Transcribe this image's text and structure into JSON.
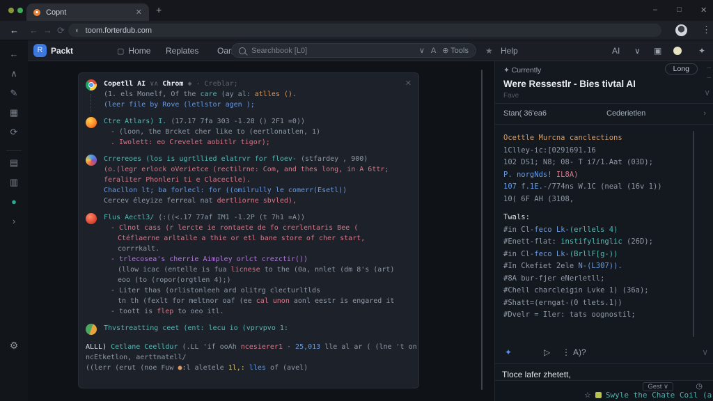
{
  "colors": {
    "accent_teal": "#56b8b4",
    "accent_pink": "#d77787",
    "accent_blue": "#6a9ae0",
    "accent_purple": "#b07ad6",
    "accent_orange": "#d79a62",
    "brand_blue": "#3b78e0",
    "panel_bg": "#14181f",
    "card_bg": "#1c212a"
  },
  "icons": {
    "back": "←",
    "fwd": "→",
    "reload": "⟳",
    "close": "✕",
    "plus": "+",
    "minimize": "–",
    "maximize": "□",
    "kebab": "⋮",
    "globe": "◐",
    "star": "★",
    "star_o": "☆",
    "gear": "⚙",
    "chev_down": "∨",
    "chev_right": "›",
    "play": "▷",
    "diamond": "◆",
    "sparkle": "✦",
    "tools": "⊕ Tools",
    "person": "A",
    "clip": "▣",
    "dash": "–"
  },
  "window": {
    "tab_title": "Copnt",
    "url": "toom.forterdub.com"
  },
  "rail": {
    "items": [
      {
        "g": "←",
        "n": "back"
      },
      {
        "g": "∧",
        "n": "caret-up"
      },
      {
        "g": "✎",
        "n": "edit"
      },
      {
        "g": "▦",
        "n": "grid"
      },
      {
        "g": "⟳",
        "n": "history"
      },
      {
        "g": "",
        "n": "divider"
      },
      {
        "g": "▤",
        "n": "folder"
      },
      {
        "g": "▥",
        "n": "apps"
      },
      {
        "g": "●",
        "n": "status"
      },
      {
        "g": "›",
        "n": "expand"
      }
    ],
    "bottom_glyph": "⚙"
  },
  "nav": {
    "brand": "Packt",
    "brand_glyph": "R",
    "items": [
      "Home",
      "Replates",
      "Oama"
    ],
    "home_icon": "▢",
    "search_placeholder": "Searchbook [L0]",
    "help": "Help",
    "ai": "AI"
  },
  "chat": {
    "messages": [
      {
        "avatar": "av-chrome",
        "thread": true,
        "header": [
          {
            "t": "Copetll AI",
            "c": "wb"
          },
          {
            "t": " ∨∧ ",
            "c": "f"
          },
          {
            "t": "Chrom",
            "c": "wb"
          },
          {
            "t": " ◆",
            "c": "f"
          },
          {
            "t": "   · Creblar;",
            "c": "f"
          }
        ],
        "lines": [
          {
            "ind": 0,
            "segs": [
              {
                "t": "(1. els Monelf, Of the ",
                "c": "g"
              },
              {
                "t": "care",
                "c": "t"
              },
              {
                "t": " (ay al: ",
                "c": "g"
              },
              {
                "t": "atlles ()",
                "c": "o"
              },
              {
                "t": ".",
                "c": "g"
              }
            ]
          },
          {
            "ind": 0,
            "segs": [
              {
                "t": "(leer file by Rove (letlstor agen );",
                "c": "b"
              }
            ]
          }
        ]
      },
      {
        "avatar": "av-firefox",
        "header": [
          {
            "t": "Ctre Atlars) I. ",
            "c": "t"
          },
          {
            "t": "(17.17 7fa 303 -1.28 () 2F1 =0))",
            "c": "g"
          }
        ],
        "lines": [
          {
            "ind": 1,
            "segs": [
              {
                "t": "- (loon, the Brcket cher like to (eertlonatlen, 1)",
                "c": "g"
              }
            ]
          },
          {
            "ind": 1,
            "segs": [
              {
                "t": ". Iwolett: eo Crevelet aobitlr tigor);",
                "c": "p"
              }
            ]
          }
        ]
      },
      {
        "avatar": "av-swirl",
        "header": [
          {
            "t": "Crrereoes (los is ugrtllied elatrvr for floev- ",
            "c": "t"
          },
          {
            "t": "(stfardey , 900)",
            "c": "g"
          }
        ],
        "lines": [
          {
            "ind": 0,
            "segs": [
              {
                "t": "(o.(legr erlock oVerietce (rectilrne: Com, and thes long, in A 6ttr;",
                "c": "p"
              }
            ]
          },
          {
            "ind": 0,
            "segs": [
              {
                "t": "feraliter Phonleri ti e Clacectle).",
                "c": "p"
              }
            ]
          },
          {
            "ind": 0,
            "segs": [
              {
                "t": "Chacllon lt; ba forlecl: for ((omilrully le comerr(Esetl))",
                "c": "b"
              }
            ]
          },
          {
            "ind": 0,
            "segs": [
              {
                "t": "Cercev éleyize ferreal nat ",
                "c": "g"
              },
              {
                "t": "dertliorne sbvled),",
                "c": "p"
              }
            ]
          }
        ]
      },
      {
        "avatar": "av-red",
        "header": [
          {
            "t": "Flus Aectl3/ ",
            "c": "t"
          },
          {
            "t": "(:((<.17 77af IM1 -1.2P (t 7h1 =A))",
            "c": "g"
          }
        ],
        "lines": [
          {
            "ind": 1,
            "segs": [
              {
                "t": "- Clnot cass (r lercte ie rontaete de fo crerlentaris Bee (",
                "c": "p"
              }
            ]
          },
          {
            "ind": 2,
            "segs": [
              {
                "t": "Ctéflaerne arltalle a thie or etl bane store of cher start,",
                "c": "p"
              }
            ]
          },
          {
            "ind": 2,
            "segs": [
              {
                "t": "corrrkalt.",
                "c": "g"
              }
            ]
          },
          {
            "ind": 1,
            "segs": [
              {
                "t": "- trlecosea's cherrie Aimpley orlct crezctir())",
                "c": "u"
              }
            ]
          },
          {
            "ind": 2,
            "segs": [
              {
                "t": "(llow icac (entelle is fua ",
                "c": "g"
              },
              {
                "t": "licnese",
                "c": "p"
              },
              {
                "t": " to the (0a, nnlet (dm 8's (art)",
                "c": "g"
              }
            ]
          },
          {
            "ind": 2,
            "segs": [
              {
                "t": "eoo (to (ropor(orgtlen 4);)",
                "c": "g"
              }
            ]
          },
          {
            "ind": 1,
            "segs": [
              {
                "t": "- Liter thas (orlistonleeh ard olitrg clecturltlds",
                "c": "g"
              }
            ]
          },
          {
            "ind": 2,
            "segs": [
              {
                "t": "tn th (fexlt for meltnor oaf (ee ",
                "c": "g"
              },
              {
                "t": "cal unon",
                "c": "p"
              },
              {
                "t": " aonl eestr is engared it",
                "c": "g"
              }
            ]
          },
          {
            "ind": 1,
            "segs": [
              {
                "t": "- toott is ",
                "c": "g"
              },
              {
                "t": "flep",
                "c": "p"
              },
              {
                "t": " to oeo itl.",
                "c": "g"
              }
            ]
          }
        ]
      },
      {
        "avatar": "av-leaf",
        "header": [
          {
            "t": "Thvstreatting ceet (ent: lecu io (vprvpvo 1:",
            "c": "t"
          }
        ],
        "lines": []
      }
    ],
    "footer_lines": [
      {
        "ind": 0,
        "segs": [
          {
            "t": "ALLL) ",
            "c": "w"
          },
          {
            "t": "Cetlane Ceelldur",
            "c": "t"
          },
          {
            "t": " (.LL 'if ooAh ",
            "c": "g"
          },
          {
            "t": "ncesierer1",
            "c": "p"
          },
          {
            "t": " · ",
            "c": "g"
          },
          {
            "t": "25,013",
            "c": "b"
          },
          {
            "t": " lle al ar ( (lne 't on",
            "c": "g"
          }
        ]
      },
      {
        "ind": 0,
        "segs": [
          {
            "t": "ncEtketlon, aerttnatell/",
            "c": "g"
          }
        ]
      },
      {
        "ind": 0,
        "segs": [
          {
            "t": "((lerr (erut (noe Fuw ",
            "c": "g"
          },
          {
            "t": "●",
            "c": "o"
          },
          {
            "t": ":l aletele ",
            "c": "g"
          },
          {
            "t": "1l,:",
            "c": "y"
          },
          {
            "t": " ",
            "c": "g"
          },
          {
            "t": "lles",
            "c": "b"
          },
          {
            "t": " of (avel)",
            "c": "g"
          }
        ]
      }
    ]
  },
  "panel": {
    "currently": "✦ Currently",
    "long": "Long",
    "title": "Were Ressestlr - Bies tivtal AI",
    "subtitle": "Fave",
    "tab_left": "Stan( 36'ea6",
    "tab_right": "Cederietlen",
    "code_lines": [
      {
        "segs": [
          {
            "t": "Ocettle Murcna canclections",
            "c": "o"
          }
        ]
      },
      {
        "segs": [
          {
            "t": "1Clley-ic:[0291691.16",
            "c": "g"
          }
        ]
      },
      {
        "segs": [
          {
            "t": "102 DS1; N8; 08- T i7/1.Aat (03D);",
            "c": "g"
          }
        ]
      },
      {
        "segs": [
          {
            "t": "P. norgNds! ",
            "c": "b"
          },
          {
            "t": "IL8A)",
            "c": "p"
          }
        ]
      },
      {
        "segs": [
          {
            "t": "107 f.1E.",
            "c": "b"
          },
          {
            "t": "-/774ns W.1C (neal (16v 1))",
            "c": "g"
          }
        ]
      },
      {
        "segs": [
          {
            "t": "10( 6F AH (3108,",
            "c": "g"
          }
        ]
      }
    ],
    "totals_heading": "Twals:",
    "totals": [
      {
        "segs": [
          {
            "t": "#in Cl-",
            "c": "g"
          },
          {
            "t": "feco Lk-",
            "c": "b"
          },
          {
            "t": "(erllels 4)",
            "c": "t"
          }
        ]
      },
      {
        "segs": [
          {
            "t": "#Enett-flat: ",
            "c": "g"
          },
          {
            "t": "instifylinglic",
            "c": "t"
          },
          {
            "t": " (26D);",
            "c": "g"
          }
        ]
      },
      {
        "segs": [
          {
            "t": "#in Cl-",
            "c": "g"
          },
          {
            "t": "feco Lk-",
            "c": "b"
          },
          {
            "t": "(BrllF[g-))",
            "c": "t"
          }
        ]
      },
      {
        "segs": [
          {
            "t": "#In Ckefiet 2ele ",
            "c": "g"
          },
          {
            "t": "N-(L307))",
            "c": "b"
          },
          {
            "t": ".",
            "c": "g"
          }
        ]
      },
      {
        "segs": [
          {
            "t": "#8A bur-fjer eNerletll;",
            "c": "g"
          }
        ]
      },
      {
        "segs": [
          {
            "t": "#Chell charcleigin Lvke 1) (36a);",
            "c": "g"
          }
        ]
      },
      {
        "segs": [
          {
            "t": "#Shatt=(erngat-(0 tlets.1))",
            "c": "g"
          }
        ]
      },
      {
        "segs": [
          {
            "t": "#Dvelr = Iler: tats oognostil;",
            "c": "g"
          }
        ]
      }
    ],
    "controls": {
      "sparkle": "✦",
      "play": "▷",
      "dots": "⋮",
      "label": "A)?"
    },
    "note": "Tloce lafer zhetett,",
    "gest": "Gest ∨",
    "clock": "◷",
    "suggestion": "Swyle the Chate Coil (ara;tn"
  }
}
